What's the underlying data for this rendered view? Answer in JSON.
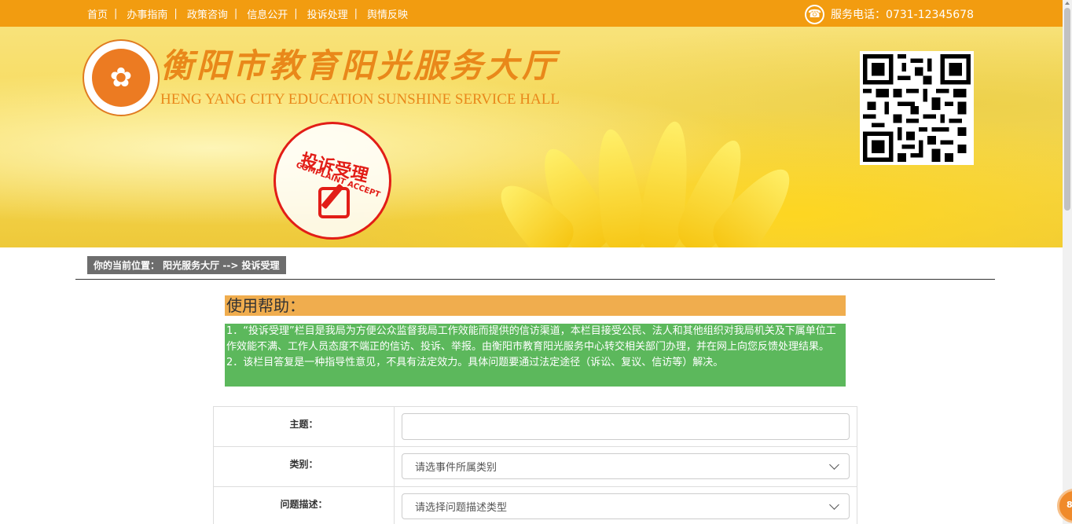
{
  "nav": {
    "items": [
      {
        "label": "首页"
      },
      {
        "label": "办事指南"
      },
      {
        "label": "政策咨询"
      },
      {
        "label": "信息公开"
      },
      {
        "label": "投诉处理"
      },
      {
        "label": "舆情反映"
      }
    ],
    "separator": "|",
    "phone_text": "服务电话：0731-12345678",
    "phone_icon": "phone-icon"
  },
  "banner": {
    "title_cn": "衡阳市教育阳光服务大厅",
    "title_en": "HENG YANG CITY EDUCATION SUNSHINE SERVICE HALL",
    "stamp_title": "投诉受理",
    "stamp_subtitle": "COMPLAINT ACCEPT"
  },
  "breadcrumb": {
    "text": "你的当前位置： 阳光服务大厅 -->  投诉受理"
  },
  "help": {
    "title": "使用帮助：",
    "line1": "1．“投诉受理”栏目是我局为方便公众监督我局工作效能而提供的信访渠道，本栏目接受公民、法人和其他组织对我局机关及下属单位工作效能不满、工作人员态度不端正的信访、投诉、举报。由衡阳市教育阳光服务中心转交相关部门办理，并在网上向您反馈处理结果。",
    "line2": "2．该栏目答复是一种指导性意见，不具有法定效力。具体问题要通过法定途径（诉讼、复议、信访等）解决。"
  },
  "form": {
    "subject_label": "主题：",
    "subject_value": "",
    "category_label": "类别：",
    "category_selected": "请选事件所属类别",
    "description_label": "问题描述：",
    "description_selected": "请选择问题描述类型"
  },
  "float_badge": "81",
  "colors": {
    "nav_bg": "#f29c10",
    "help_title_bg": "#f0ad4e",
    "help_box_bg": "#5cb85c",
    "stamp_red": "#e21d17",
    "title_orange": "#e9881a"
  }
}
